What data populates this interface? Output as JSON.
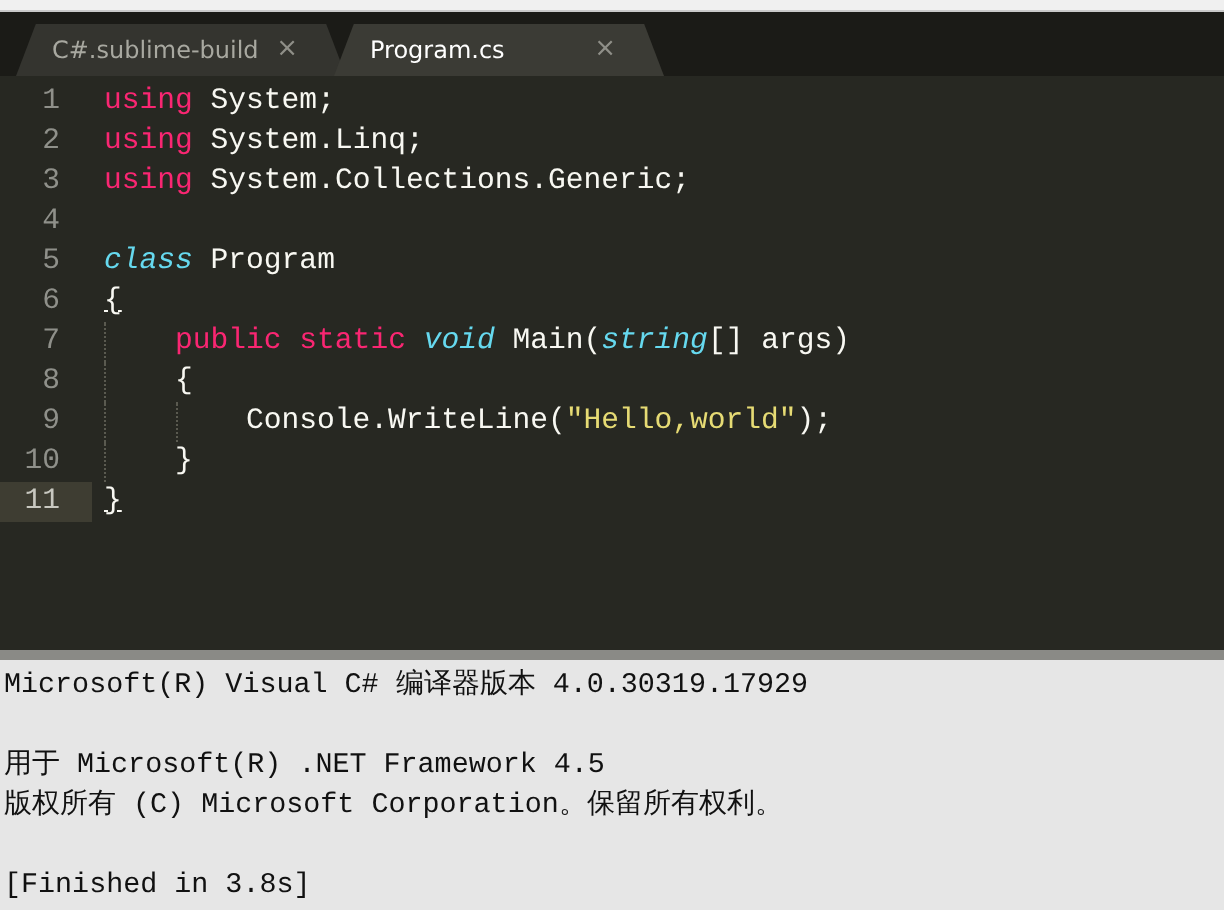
{
  "tabs": [
    {
      "label": "C#.sublime-build",
      "close": "×",
      "selected": false
    },
    {
      "label": "Program.cs",
      "close": "×",
      "selected": true
    }
  ],
  "editor": {
    "lines": [
      {
        "number": "1",
        "current": false,
        "tokens": [
          {
            "kind": "keyword",
            "text": "using"
          },
          {
            "kind": "plain",
            "text": " System;"
          }
        ]
      },
      {
        "number": "2",
        "current": false,
        "tokens": [
          {
            "kind": "keyword",
            "text": "using"
          },
          {
            "kind": "plain",
            "text": " System.Linq;"
          }
        ]
      },
      {
        "number": "3",
        "current": false,
        "tokens": [
          {
            "kind": "keyword",
            "text": "using"
          },
          {
            "kind": "plain",
            "text": " System.Collections.Generic;"
          }
        ]
      },
      {
        "number": "4",
        "current": false
      },
      {
        "number": "5",
        "current": false,
        "tokens": [
          {
            "kind": "type",
            "text": "class"
          },
          {
            "kind": "plain",
            "text": " Program"
          }
        ]
      },
      {
        "number": "6",
        "current": false,
        "tokens": [
          {
            "kind": "matched",
            "text": "{"
          }
        ],
        "children": [
          {
            "number": "7",
            "current": false,
            "tokens": [
              {
                "kind": "keyword",
                "text": "public "
              },
              {
                "kind": "keyword",
                "text": "static "
              },
              {
                "kind": "type",
                "text": "void"
              },
              {
                "kind": "plain",
                "text": " Main("
              },
              {
                "kind": "type",
                "text": "string"
              },
              {
                "kind": "plain",
                "text": "[] args)"
              }
            ]
          },
          {
            "number": "8",
            "current": false,
            "tokens": [
              {
                "kind": "plain",
                "text": "{"
              }
            ],
            "children": [
              {
                "number": "9",
                "current": false,
                "tokens": [
                  {
                    "kind": "plain",
                    "text": "Console.WriteLine("
                  },
                  {
                    "kind": "string",
                    "text": "\"Hello,world\""
                  },
                  {
                    "kind": "plain",
                    "text": ");"
                  }
                ]
              }
            ]
          },
          {
            "number": "10",
            "current": false,
            "tokens": [
              {
                "kind": "plain",
                "text": "}"
              }
            ]
          }
        ]
      },
      {
        "number": "11",
        "current": true,
        "tokens": [
          {
            "kind": "matched",
            "text": "}"
          }
        ]
      }
    ]
  },
  "output": {
    "paragraphs": [
      {
        "lines": [
          "Microsoft(R) Visual C# 编译器版本 4.0.30319.17929"
        ]
      },
      {
        "lines": [
          "用于 Microsoft(R) .NET Framework 4.5",
          "版权所有 (C) Microsoft Corporation。保留所有权利。"
        ]
      },
      {
        "lines": [
          "[Finished in 3.8s]"
        ]
      }
    ]
  }
}
